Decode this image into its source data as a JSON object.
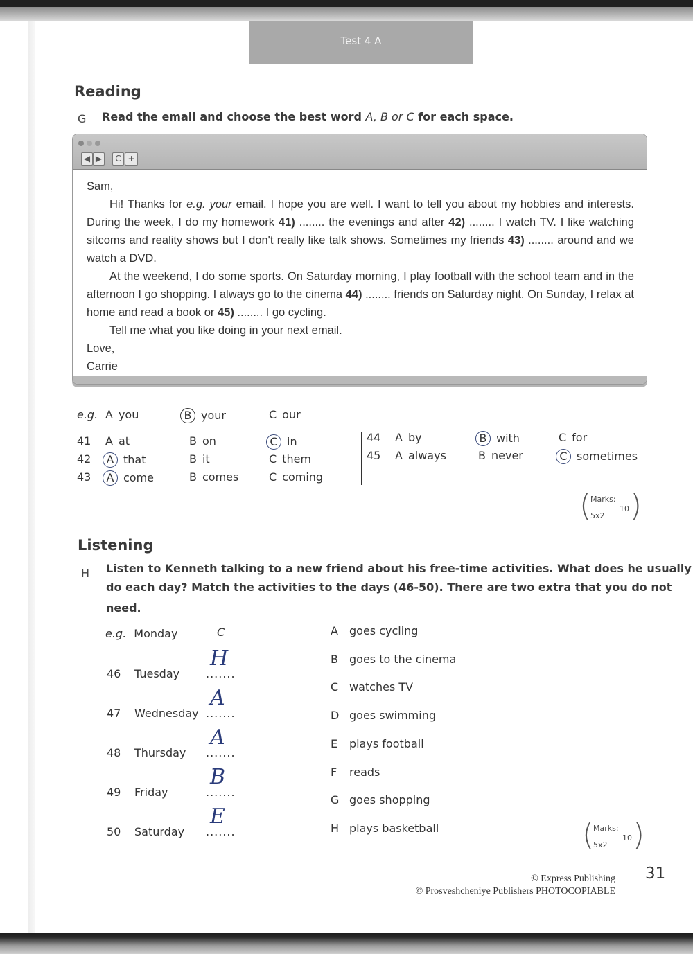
{
  "header": {
    "title": "Test 4 A"
  },
  "reading": {
    "section_title": "Reading",
    "task_letter": "G",
    "instruction_prefix": "Read the email and choose the best word ",
    "instruction_options": "A, B or C",
    "instruction_suffix": " for each space.",
    "browser": {
      "back_label": "◀",
      "forward_label": "▶",
      "reload_label": "C",
      "new_tab_label": "+"
    },
    "email": {
      "greeting": "Sam,",
      "p1_a": "Hi! Thanks for ",
      "p1_eg": "e.g. your",
      "p1_b": " email. I hope you are well. I want to tell you about my hobbies and interests. During the week, I do my homework ",
      "gap41": "41)",
      "p1_c": " ........ the evenings and after ",
      "gap42": "42)",
      "p1_d": " ........ I watch TV. I like watching sitcoms and reality shows but I don't really like talk shows. Sometimes my friends ",
      "gap43": "43)",
      "p1_e": " ........ around and we watch a DVD.",
      "p2_a": "At the weekend, I do some sports. On Saturday morning, I play football with the school team and in the afternoon I go shopping. I always go to the cinema ",
      "gap44": "44)",
      "p2_b": " ........ friends on Saturday night. On Sunday, I relax at home and read a book or ",
      "gap45": "45)",
      "p2_c": " ........ I go cycling.",
      "p3": "Tell me what you like doing in your next email.",
      "closing": "Love,",
      "signature": "Carrie"
    },
    "example": {
      "label": "e.g.",
      "options": [
        {
          "letter": "A",
          "word": "you",
          "circled": false
        },
        {
          "letter": "B",
          "word": "your",
          "circled": true
        },
        {
          "letter": "C",
          "word": "our",
          "circled": false
        }
      ]
    },
    "questions": [
      {
        "number": "41",
        "options": [
          {
            "letter": "A",
            "word": "at",
            "circled": false
          },
          {
            "letter": "B",
            "word": "on",
            "circled": false
          },
          {
            "letter": "C",
            "word": "in",
            "circled": true
          }
        ]
      },
      {
        "number": "42",
        "options": [
          {
            "letter": "A",
            "word": "that",
            "circled": true
          },
          {
            "letter": "B",
            "word": "it",
            "circled": false
          },
          {
            "letter": "C",
            "word": "them",
            "circled": false
          }
        ]
      },
      {
        "number": "43",
        "options": [
          {
            "letter": "A",
            "word": "come",
            "circled": true
          },
          {
            "letter": "B",
            "word": "comes",
            "circled": false
          },
          {
            "letter": "C",
            "word": "coming",
            "circled": false
          }
        ]
      },
      {
        "number": "44",
        "options": [
          {
            "letter": "A",
            "word": "by",
            "circled": false
          },
          {
            "letter": "B",
            "word": "with",
            "circled": true
          },
          {
            "letter": "C",
            "word": "for",
            "circled": false
          }
        ]
      },
      {
        "number": "45",
        "options": [
          {
            "letter": "A",
            "word": "always",
            "circled": false
          },
          {
            "letter": "B",
            "word": "never",
            "circled": false
          },
          {
            "letter": "C",
            "word": "sometimes",
            "circled": true
          }
        ]
      }
    ],
    "marks": {
      "label": "Marks:",
      "multiplier": "5x2",
      "total": "10"
    }
  },
  "listening": {
    "section_title": "Listening",
    "task_letter": "H",
    "instruction_line1": "Listen to Kenneth talking to a new friend about his free-time activities. What does he usually",
    "instruction_line2": "do each day? Match the activities to the days (46-50). There are two extra that you do not",
    "instruction_line3": "need.",
    "example": {
      "label": "e.g.",
      "day": "Monday",
      "answer": "C"
    },
    "days": [
      {
        "number": "46",
        "day": "Tuesday",
        "blank": ".......",
        "handwritten": "H"
      },
      {
        "number": "47",
        "day": "Wednesday",
        "blank": ".......",
        "handwritten": "A"
      },
      {
        "number": "48",
        "day": "Thursday",
        "blank": ".......",
        "handwritten": "A"
      },
      {
        "number": "49",
        "day": "Friday",
        "blank": ".......",
        "handwritten": "B"
      },
      {
        "number": "50",
        "day": "Saturday",
        "blank": ".......",
        "handwritten": "E"
      }
    ],
    "activities": [
      {
        "letter": "A",
        "text": "goes cycling"
      },
      {
        "letter": "B",
        "text": "goes to the cinema"
      },
      {
        "letter": "C",
        "text": "watches TV"
      },
      {
        "letter": "D",
        "text": "goes swimming"
      },
      {
        "letter": "E",
        "text": "plays football"
      },
      {
        "letter": "F",
        "text": "reads"
      },
      {
        "letter": "G",
        "text": "goes shopping"
      },
      {
        "letter": "H",
        "text": "plays basketball"
      }
    ],
    "marks": {
      "label": "Marks:",
      "multiplier": "5x2",
      "total": "10"
    }
  },
  "footer": {
    "publisher1": "© Express Publishing",
    "publisher2": "© Prosveshcheniye Publishers PHOTOCOPIABLE",
    "page_number": "31"
  }
}
